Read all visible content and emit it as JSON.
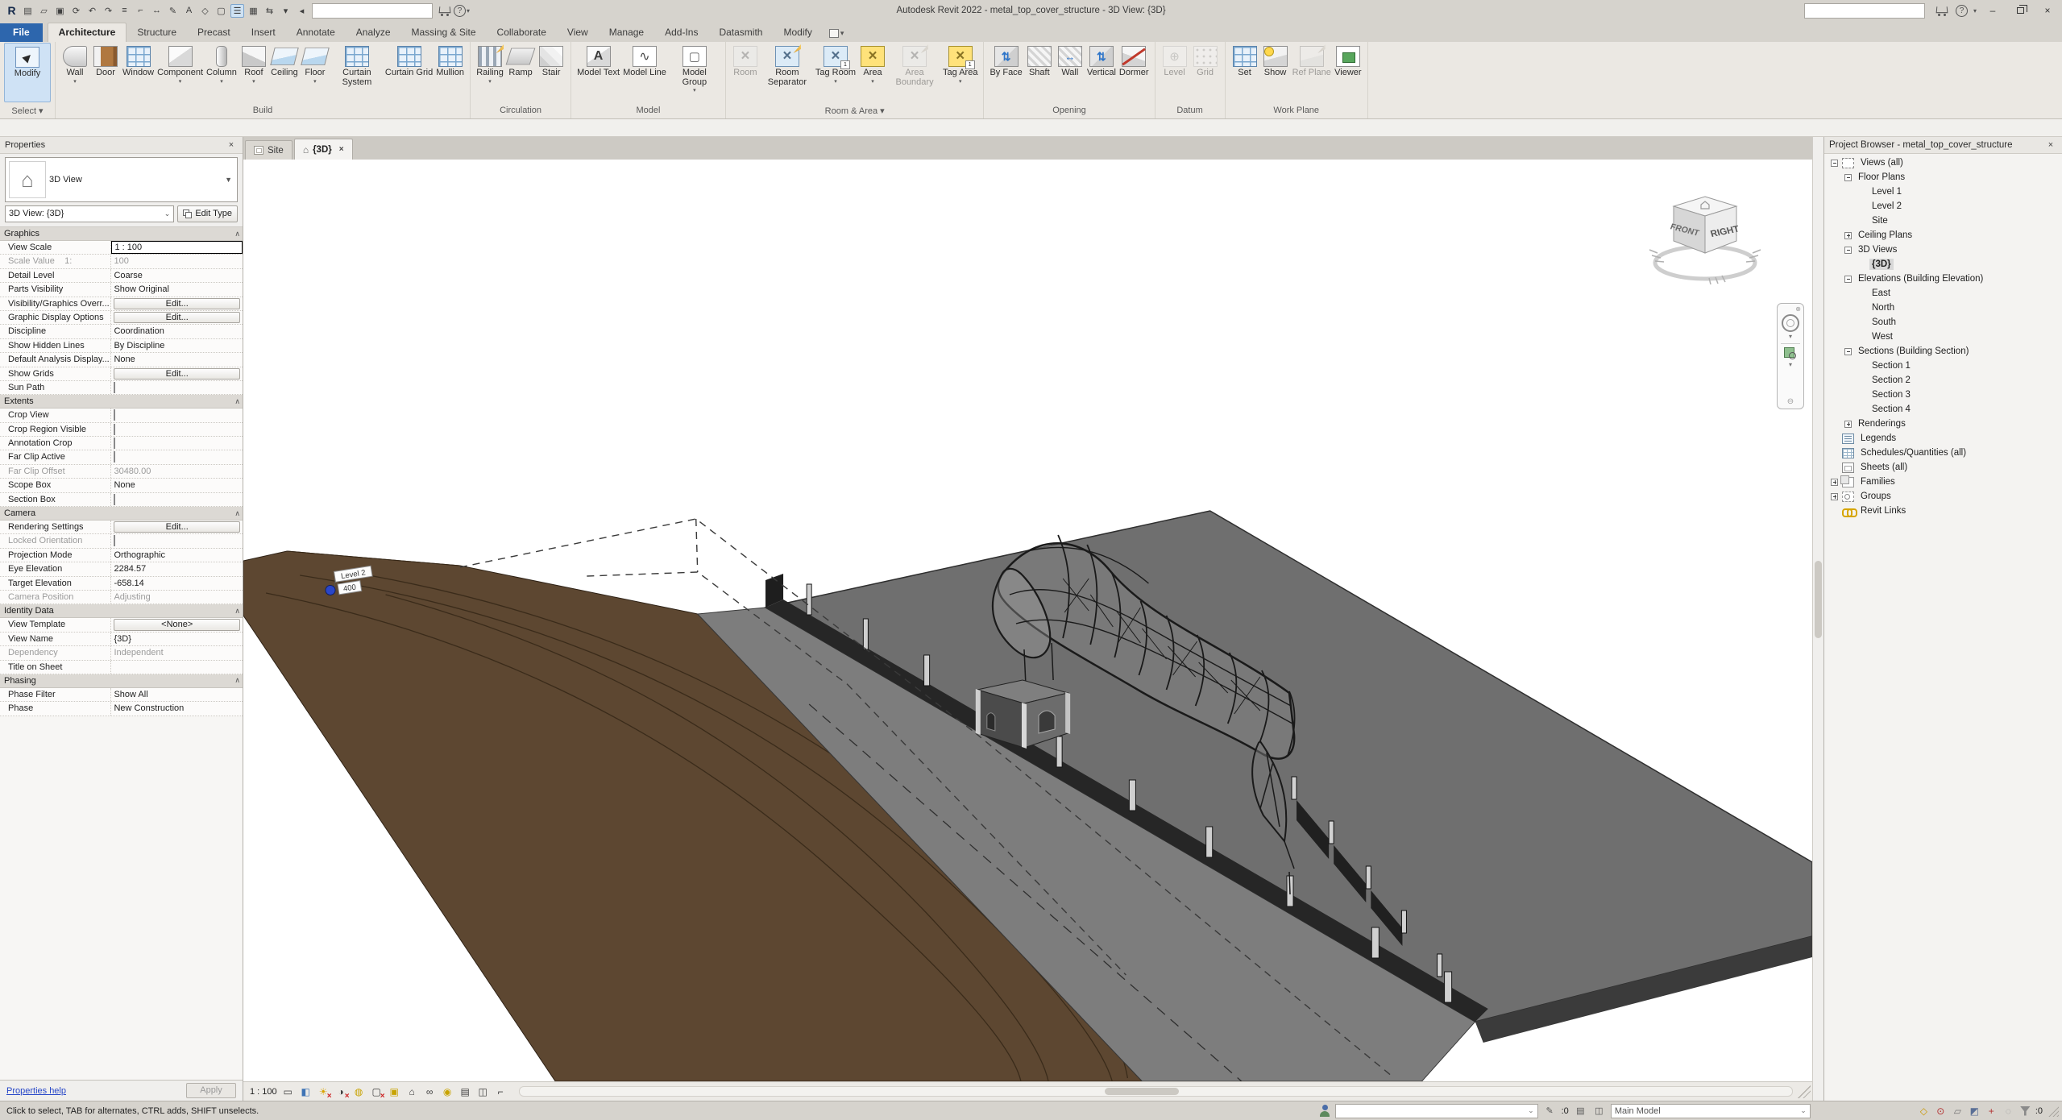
{
  "colors": {
    "file_tab_blue": "#2d66ad",
    "modify_highlight": "#cfe2f5",
    "terrain_brown": "#5d4731",
    "slab_gray": "#6f6f6f",
    "selection_gray": "#d8d8d8"
  },
  "title_bar": {
    "title": "Autodesk Revit 2022 - metal_top_cover_structure - 3D View: {3D}",
    "qat": [
      {
        "name": "revit-menu",
        "glyph": "R"
      },
      {
        "name": "new-doc",
        "glyph": "▤"
      },
      {
        "name": "open",
        "glyph": "▱"
      },
      {
        "name": "save",
        "glyph": "▣"
      },
      {
        "name": "sync",
        "glyph": "⟳"
      },
      {
        "name": "undo",
        "glyph": "↶"
      },
      {
        "name": "redo",
        "glyph": "↷"
      },
      {
        "name": "print",
        "glyph": "≡"
      },
      {
        "name": "measure",
        "glyph": "⌐"
      },
      {
        "name": "aligned-dimension",
        "glyph": "↔"
      },
      {
        "name": "tag",
        "glyph": "✎"
      },
      {
        "name": "text",
        "glyph": "A"
      },
      {
        "name": "default-3d-view",
        "glyph": "◇"
      },
      {
        "name": "section",
        "glyph": "▢"
      },
      {
        "name": "thin-lines",
        "glyph": "☰",
        "active": true
      },
      {
        "name": "close-inactive",
        "glyph": "▦"
      },
      {
        "name": "switch-windows",
        "glyph": "⇆"
      },
      {
        "name": "customize",
        "glyph": "▾"
      },
      {
        "name": "collapse",
        "glyph": "◂"
      }
    ]
  },
  "ribbon": {
    "tabs": [
      {
        "label": "File",
        "file": true
      },
      {
        "label": "Architecture",
        "active": true
      },
      {
        "label": "Structure"
      },
      {
        "label": "Precast"
      },
      {
        "label": "Insert"
      },
      {
        "label": "Annotate"
      },
      {
        "label": "Analyze"
      },
      {
        "label": "Massing & Site"
      },
      {
        "label": "Collaborate"
      },
      {
        "label": "View"
      },
      {
        "label": "Manage"
      },
      {
        "label": "Add-Ins"
      },
      {
        "label": "Datasmith"
      },
      {
        "label": "Modify"
      }
    ],
    "panels": [
      {
        "name": "Select",
        "arrow": true,
        "buttons": [
          {
            "label": "Modify",
            "icon": "modify",
            "modify": true
          }
        ]
      },
      {
        "name": "Build",
        "buttons": [
          {
            "label": "Wall",
            "icon": "wall",
            "arrow": true
          },
          {
            "label": "Door",
            "icon": "door"
          },
          {
            "label": "Window",
            "icon": "window"
          },
          {
            "label": "Component",
            "icon": "component",
            "arrow": true
          },
          {
            "label": "Column",
            "icon": "column",
            "arrow": true
          },
          {
            "label": "Roof",
            "icon": "roof",
            "arrow": true
          },
          {
            "label": "Ceiling",
            "icon": "ceiling"
          },
          {
            "label": "Floor",
            "icon": "floor",
            "arrow": true
          },
          {
            "label": "Curtain System",
            "icon": "curtain-system"
          },
          {
            "label": "Curtain Grid",
            "icon": "curtain-grid"
          },
          {
            "label": "Mullion",
            "icon": "mullion"
          }
        ]
      },
      {
        "name": "Circulation",
        "buttons": [
          {
            "label": "Railing",
            "icon": "railing",
            "arrow": true
          },
          {
            "label": "Ramp",
            "icon": "ramp"
          },
          {
            "label": "Stair",
            "icon": "stair"
          }
        ]
      },
      {
        "name": "Model",
        "buttons": [
          {
            "label": "Model Text",
            "icon": "model-text"
          },
          {
            "label": "Model Line",
            "icon": "model-line"
          },
          {
            "label": "Model Group",
            "icon": "model-group",
            "arrow": true
          }
        ]
      },
      {
        "name": "Room & Area",
        "arrow": true,
        "buttons": [
          {
            "label": "Room",
            "icon": "room",
            "disabled": true
          },
          {
            "label": "Room Separator",
            "icon": "room-separator"
          },
          {
            "label": "Tag Room",
            "icon": "tag-room",
            "arrow": true
          },
          {
            "label": "Area",
            "icon": "area",
            "arrow": true
          },
          {
            "label": "Area Boundary",
            "icon": "area-boundary",
            "disabled": true
          },
          {
            "label": "Tag Area",
            "icon": "tag-area",
            "arrow": true
          }
        ]
      },
      {
        "name": "Opening",
        "buttons": [
          {
            "label": "By Face",
            "icon": "by-face"
          },
          {
            "label": "Shaft",
            "icon": "shaft"
          },
          {
            "label": "Wall",
            "icon": "wall-opening"
          },
          {
            "label": "Vertical",
            "icon": "vertical"
          },
          {
            "label": "Dormer",
            "icon": "dormer"
          }
        ]
      },
      {
        "name": "Datum",
        "buttons": [
          {
            "label": "Level",
            "icon": "level",
            "disabled": true
          },
          {
            "label": "Grid",
            "icon": "grid",
            "disabled": true
          }
        ]
      },
      {
        "name": "Work Plane",
        "buttons": [
          {
            "label": "Set",
            "icon": "set"
          },
          {
            "label": "Show",
            "icon": "show"
          },
          {
            "label": "Ref Plane",
            "icon": "ref-plane",
            "disabled": true
          },
          {
            "label": "Viewer",
            "icon": "viewer"
          }
        ]
      }
    ]
  },
  "properties": {
    "header": "Properties",
    "type_selector": "3D View",
    "instance_combo": "3D View: {3D}",
    "edit_type": "Edit Type",
    "sections": [
      {
        "name": "Graphics",
        "rows": [
          {
            "label": "View Scale",
            "value": "1 : 100",
            "kind": "selected"
          },
          {
            "label": "Scale Value    1:",
            "value": "100",
            "kind": "muted",
            "label_muted": true
          },
          {
            "label": "Detail Level",
            "value": "Coarse"
          },
          {
            "label": "Parts Visibility",
            "value": "Show Original"
          },
          {
            "label": "Visibility/Graphics Overr...",
            "value": "Edit...",
            "kind": "button"
          },
          {
            "label": "Graphic Display Options",
            "value": "Edit...",
            "kind": "button"
          },
          {
            "label": "Discipline",
            "value": "Coordination"
          },
          {
            "label": "Show Hidden Lines",
            "value": "By Discipline"
          },
          {
            "label": "Default Analysis Display...",
            "value": "None"
          },
          {
            "label": "Show Grids",
            "value": "Edit...",
            "kind": "button"
          },
          {
            "label": "Sun Path",
            "kind": "checkbox"
          }
        ]
      },
      {
        "name": "Extents",
        "rows": [
          {
            "label": "Crop View",
            "kind": "checkbox"
          },
          {
            "label": "Crop Region Visible",
            "kind": "checkbox"
          },
          {
            "label": "Annotation Crop",
            "kind": "checkbox"
          },
          {
            "label": "Far Clip Active",
            "kind": "checkbox"
          },
          {
            "label": "Far Clip Offset",
            "value": "30480.00",
            "kind": "muted",
            "label_muted": true
          },
          {
            "label": "Scope Box",
            "value": "None"
          },
          {
            "label": "Section Box",
            "kind": "checkbox"
          }
        ]
      },
      {
        "name": "Camera",
        "rows": [
          {
            "label": "Rendering Settings",
            "value": "Edit...",
            "kind": "button"
          },
          {
            "label": "Locked Orientation",
            "kind": "checkbox",
            "label_muted": true
          },
          {
            "label": "Projection Mode",
            "value": "Orthographic"
          },
          {
            "label": "Eye Elevation",
            "value": "2284.57"
          },
          {
            "label": "Target Elevation",
            "value": "-658.14"
          },
          {
            "label": "Camera Position",
            "value": "Adjusting",
            "kind": "muted",
            "label_muted": true
          }
        ]
      },
      {
        "name": "Identity Data",
        "rows": [
          {
            "label": "View Template",
            "value": "<None>",
            "kind": "button"
          },
          {
            "label": "View Name",
            "value": "{3D}"
          },
          {
            "label": "Dependency",
            "value": "Independent",
            "kind": "muted",
            "label_muted": true
          },
          {
            "label": "Title on Sheet",
            "value": ""
          }
        ]
      },
      {
        "name": "Phasing",
        "rows": [
          {
            "label": "Phase Filter",
            "value": "Show All"
          },
          {
            "label": "Phase",
            "value": "New Construction"
          }
        ]
      }
    ],
    "footer": {
      "help": "Properties help",
      "apply": "Apply"
    }
  },
  "view_tabs": [
    {
      "label": "Site"
    },
    {
      "label": "{3D}",
      "active": true
    }
  ],
  "viewcube": {
    "right_face": "RIGHT",
    "front_face": "FRONT"
  },
  "canvas": {
    "level_tag": {
      "name": "Level 2",
      "elevation": "400"
    }
  },
  "view_control_bar": {
    "scale": "1 : 100",
    "icons": [
      {
        "name": "detail-level",
        "glyph": "▭"
      },
      {
        "name": "visual-style",
        "glyph": "◧",
        "cls": "c-blue"
      },
      {
        "name": "sun-path",
        "glyph": "☀",
        "cls": "c-sun redx"
      },
      {
        "name": "shadows",
        "glyph": "◑",
        "cls": "redx"
      },
      {
        "name": "rendering-dialog",
        "glyph": "◍",
        "cls": "c-bulb"
      },
      {
        "name": "crop-view",
        "glyph": "▢",
        "cls": "redx"
      },
      {
        "name": "crop-region",
        "glyph": "▣",
        "cls": "c-bulb"
      },
      {
        "name": "view-lock",
        "glyph": "⌂"
      },
      {
        "name": "hide-isolate",
        "glyph": "∞"
      },
      {
        "name": "reveal-hidden",
        "glyph": "◉",
        "cls": "c-bulb"
      },
      {
        "name": "temp-view-properties",
        "glyph": "▤"
      },
      {
        "name": "displaced-elements",
        "glyph": "◫"
      },
      {
        "name": "reveal-constraints",
        "glyph": "⌐"
      }
    ]
  },
  "project_browser": {
    "header": "Project Browser - metal_top_cover_structure",
    "tree": [
      {
        "depth": 0,
        "exp": "minus",
        "icon": "views",
        "label": "Views (all)"
      },
      {
        "depth": 1,
        "exp": "minus",
        "label": "Floor Plans"
      },
      {
        "depth": 2,
        "label": "Level 1"
      },
      {
        "depth": 2,
        "label": "Level 2"
      },
      {
        "depth": 2,
        "label": "Site"
      },
      {
        "depth": 1,
        "exp": "plus",
        "label": "Ceiling Plans"
      },
      {
        "depth": 1,
        "exp": "minus",
        "label": "3D Views"
      },
      {
        "depth": 2,
        "label": "{3D}",
        "selected": true
      },
      {
        "depth": 1,
        "exp": "minus",
        "label": "Elevations (Building Elevation)"
      },
      {
        "depth": 2,
        "label": "East"
      },
      {
        "depth": 2,
        "label": "North"
      },
      {
        "depth": 2,
        "label": "South"
      },
      {
        "depth": 2,
        "label": "West"
      },
      {
        "depth": 1,
        "exp": "minus",
        "label": "Sections (Building Section)"
      },
      {
        "depth": 2,
        "label": "Section 1"
      },
      {
        "depth": 2,
        "label": "Section 2"
      },
      {
        "depth": 2,
        "label": "Section 3"
      },
      {
        "depth": 2,
        "label": "Section 4"
      },
      {
        "depth": 1,
        "exp": "plus",
        "label": "Renderings"
      },
      {
        "depth": 0,
        "icon": "legends",
        "label": "Legends"
      },
      {
        "depth": 0,
        "icon": "schedules",
        "label": "Schedules/Quantities (all)"
      },
      {
        "depth": 0,
        "icon": "sheets",
        "label": "Sheets (all)"
      },
      {
        "depth": 0,
        "exp": "plus",
        "icon": "families",
        "label": "Families"
      },
      {
        "depth": 0,
        "exp": "plus",
        "icon": "groups",
        "label": "Groups"
      },
      {
        "depth": 0,
        "icon": "links",
        "label": "Revit Links"
      }
    ]
  },
  "status_bar": {
    "hint": "Click to select, TAB for alternates, CTRL adds, SHIFT unselects.",
    "editable_count": ":0",
    "main_model": "Main Model",
    "filter_count": ":0",
    "cluster": [
      {
        "name": "select-links",
        "glyph": "◇",
        "color": "#c99700"
      },
      {
        "name": "select-pinned",
        "glyph": "⊙",
        "color": "#b33333"
      },
      {
        "name": "select-underlay",
        "glyph": "▱",
        "color": "#777777"
      },
      {
        "name": "select-by-face",
        "glyph": "◩",
        "color": "#5a6f96"
      },
      {
        "name": "drag-on-selection",
        "glyph": "+",
        "color": "#b33333"
      },
      {
        "name": "background-process",
        "glyph": "◌",
        "color": "#999999"
      }
    ]
  }
}
